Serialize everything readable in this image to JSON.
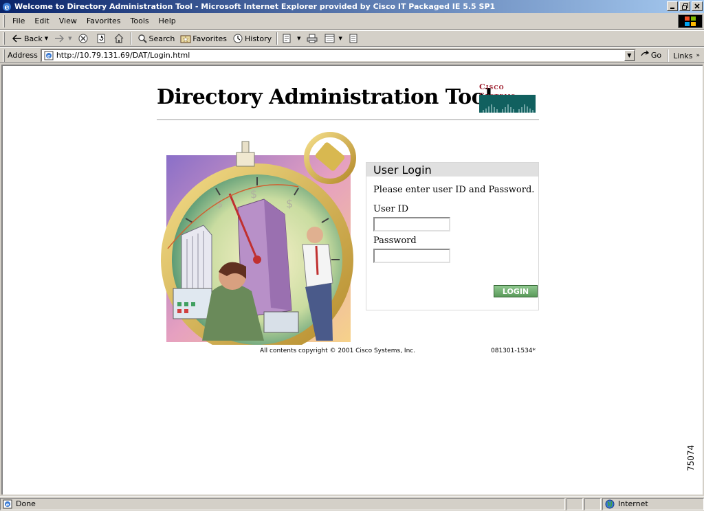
{
  "window": {
    "title": "Welcome to Directory Administration Tool - Microsoft Internet Explorer provided by Cisco IT Packaged IE 5.5 SP1",
    "minimize": "0",
    "restore": "1",
    "close": "r"
  },
  "menubar": {
    "items": [
      "File",
      "Edit",
      "View",
      "Favorites",
      "Tools",
      "Help"
    ]
  },
  "toolbar": {
    "back_label": "Back",
    "search_label": "Search",
    "favorites_label": "Favorites",
    "history_label": "History"
  },
  "address": {
    "label": "Address",
    "url": "http://10.79.131.69/DAT/Login.html",
    "go_label": "Go",
    "links_label": "Links"
  },
  "page": {
    "heading": "Directory Administration Tool",
    "brand_text": "Cisco Systems",
    "login": {
      "header": "User Login",
      "prompt": "Please enter user ID and Password.",
      "user_id_label": "User ID",
      "user_id_value": "",
      "password_label": "Password",
      "password_value": "",
      "button_label": "LOGIN"
    },
    "copyright": "All contents copyright © 2001 Cisco Systems, Inc.",
    "build_id": "081301-1534*",
    "figure_number": "75074"
  },
  "status": {
    "text": "Done",
    "zone": "Internet"
  }
}
